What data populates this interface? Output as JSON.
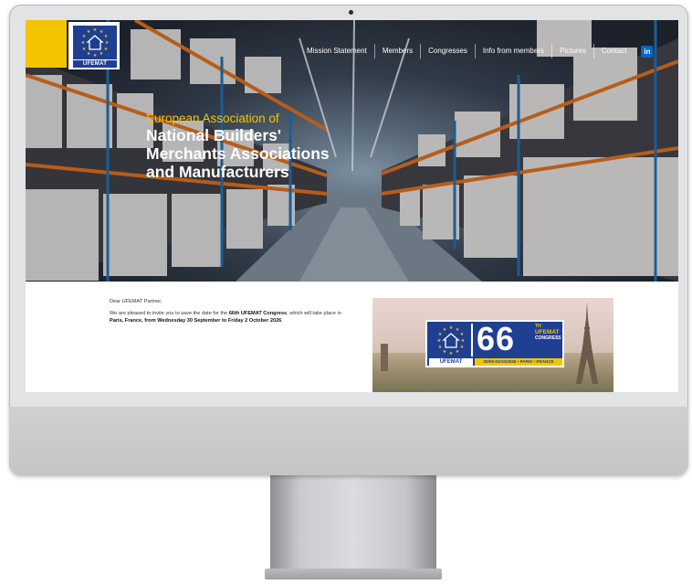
{
  "site": {
    "logo_text": "UFEMAT",
    "nav": [
      "Mission Statement",
      "Members",
      "Congresses",
      "Info from members",
      "Pictures",
      "Contact"
    ],
    "linkedin_label": "in"
  },
  "hero": {
    "subtitle": "European Association of",
    "title_lines": [
      "National Builders'",
      "Merchants Associations",
      "and Manufacturers"
    ]
  },
  "letter": {
    "greeting": "Dear UFEMAT Partner,",
    "p1_part1": "We are pleased to invite you to save the date for the ",
    "p1_bold1": "66th UFEMAT Congress",
    "p1_part2": ", which will take place in ",
    "p1_bold2": "Paris, France, from Wednesday 30 September to Friday 2 October 2026",
    "p1_end": "."
  },
  "banner": {
    "org": "UFEMAT",
    "number": "66",
    "ordinal": "TH",
    "name": "UFEMAT",
    "congress": "CONGRESS",
    "dateline": "30/09-02/10/2026 • PARIS • FRANCE"
  },
  "colors": {
    "brand_yellow": "#f5c400",
    "brand_blue": "#1f3f93",
    "linkedin_blue": "#0a66c2"
  },
  "icons": {
    "logo": "eu-stars-house-emblem",
    "social": "linkedin-icon"
  }
}
